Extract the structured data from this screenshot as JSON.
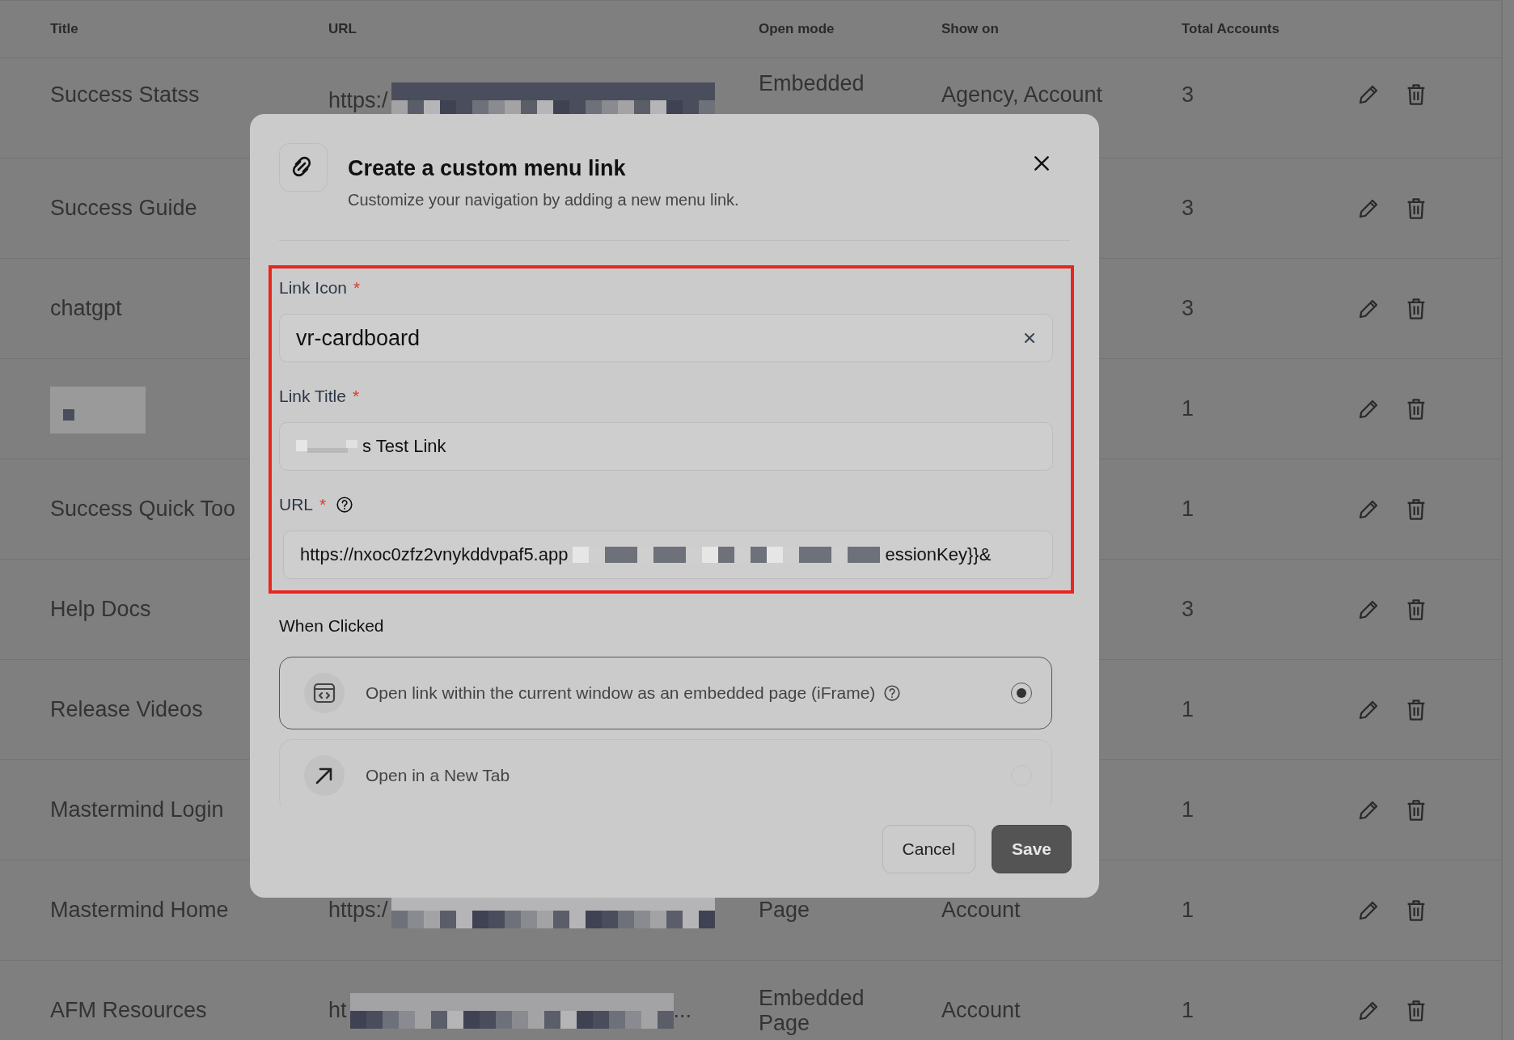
{
  "table": {
    "columns": [
      "Title",
      "URL",
      "Open mode",
      "Show on",
      "Total Accounts"
    ],
    "rows": [
      {
        "title": "Success Statss",
        "url_start": "https:/",
        "url_redacted": true,
        "open_mode": [
          "Embedded"
        ],
        "show_on": "Agency, Account",
        "total": "3"
      },
      {
        "title": "Success Guide",
        "total": "3"
      },
      {
        "title": "chatgpt",
        "total": "3"
      },
      {
        "title_redacted": true,
        "total": "1"
      },
      {
        "title": "Success Quick Too",
        "total": "1"
      },
      {
        "title": "Help Docs",
        "total": "3"
      },
      {
        "title": "Release Videos",
        "total": "1"
      },
      {
        "title": "Mastermind Login",
        "total": "1"
      },
      {
        "title": "Mastermind Home",
        "url_start": "https:/",
        "url_redacted": true,
        "open_mode": [
          "Page"
        ],
        "show_on": "Account",
        "total": "1"
      },
      {
        "title": "AFM Resources",
        "url_start": "ht",
        "url_redacted": true,
        "url_end": "...",
        "open_mode": [
          "Embedded",
          "Page"
        ],
        "show_on": "Account",
        "total": "1"
      }
    ]
  },
  "modal": {
    "title": "Create a custom menu link",
    "subtitle": "Customize your navigation by adding a new menu link.",
    "fields": [
      {
        "kind": "select",
        "label": "Link Icon",
        "marker": "*",
        "value": "vr-cardboard"
      },
      {
        "kind": "text",
        "label": "Link Title",
        "marker": "*",
        "redacted_prefix": true,
        "value": "s Test Link"
      },
      {
        "kind": "url",
        "label": "URL",
        "marker": "*",
        "value": "https://nxoc0zfz2vnykddvpaf5.app",
        "redacted_middle": true,
        "value_end": "essionKey}}&"
      }
    ],
    "when_clicked": {
      "label": "When Clicked",
      "options": [
        {
          "kind": "embed",
          "label": "Open link within the current window as an embedded page (iFrame)",
          "help": true,
          "selected": true
        },
        {
          "kind": "new-tab",
          "label": "Open in a New Tab",
          "help": false,
          "selected": false
        }
      ]
    },
    "buttons": [
      {
        "kind": "secondary",
        "label": "Cancel"
      },
      {
        "kind": "primary",
        "label": "Save"
      }
    ]
  }
}
